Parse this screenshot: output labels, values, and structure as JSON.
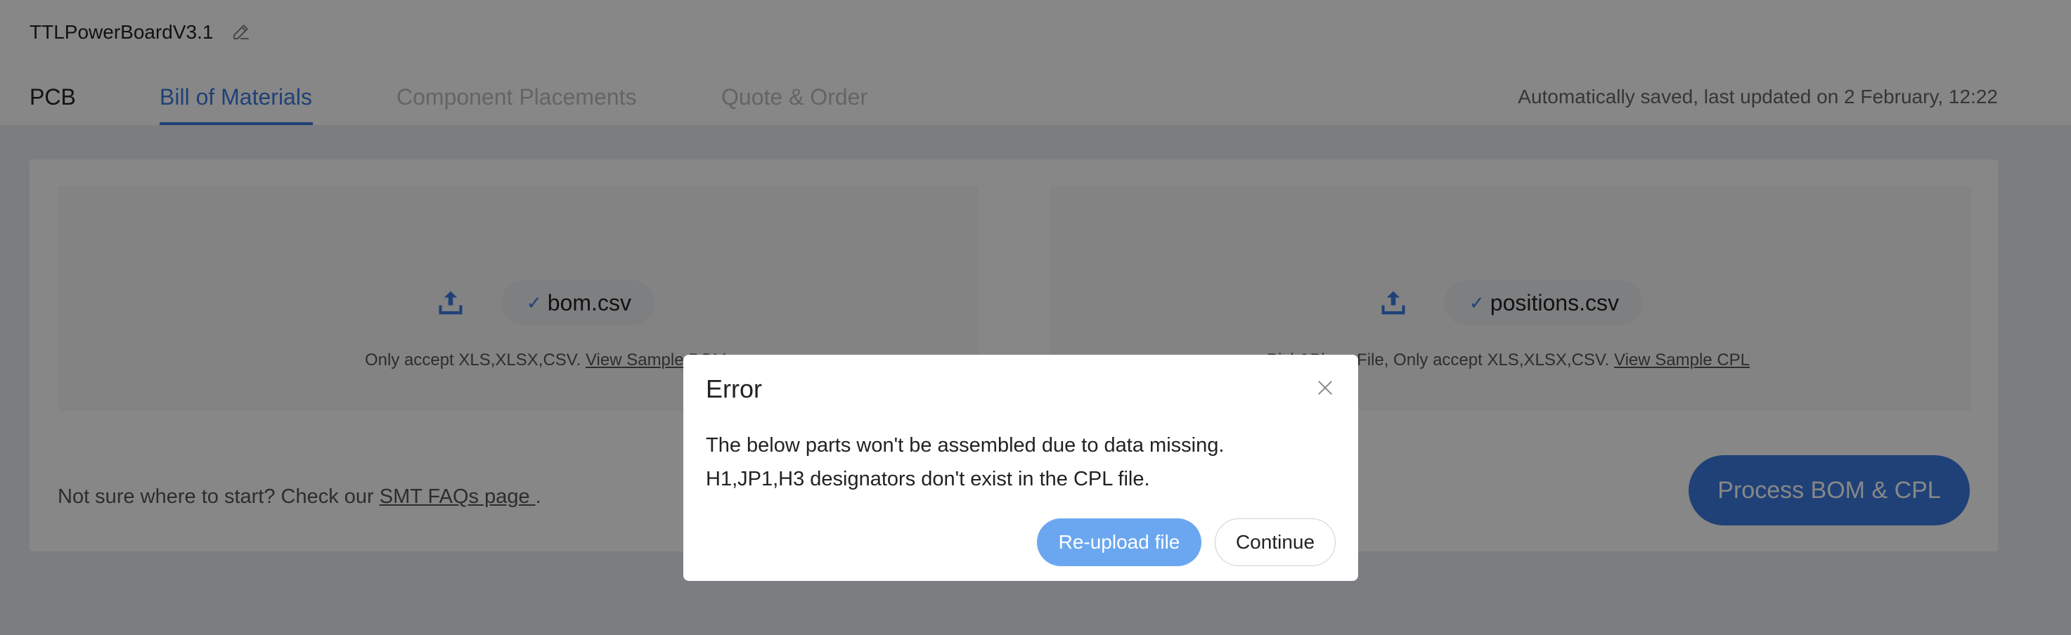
{
  "header": {
    "project_title": "TTLPowerBoardV3.1",
    "edit_icon": "pencil-icon",
    "autosave_status": "Automatically saved, last updated on 2 February, 12:22"
  },
  "tabs": [
    {
      "label": "PCB",
      "state": "normal"
    },
    {
      "label": "Bill of Materials",
      "state": "active"
    },
    {
      "label": "Component Placements",
      "state": "disabled"
    },
    {
      "label": "Quote & Order",
      "state": "disabled"
    }
  ],
  "bom_upload": {
    "icon": "upload-icon",
    "file_check": "✓",
    "file_name": "bom.csv",
    "hint": "Only accept XLS,XLSX,CSV.",
    "sample_link": "View Sample BOM"
  },
  "cpl_upload": {
    "icon": "upload-icon",
    "file_check": "✓",
    "file_name": "positions.csv",
    "hint": "Pick&Place File, Only accept XLS,XLSX,CSV.",
    "sample_link": "View Sample CPL"
  },
  "footer": {
    "faq_prefix": "Not sure where to start? Check our",
    "faq_link": "SMT FAQs page ",
    "faq_suffix": ".",
    "process_button": "Process BOM & CPL"
  },
  "dialog": {
    "title": "Error",
    "close_icon": "close-icon",
    "message_line1": "The below parts won't be assembled due to data missing.",
    "message_line2": "H1,JP1,H3 designators don't exist in the CPL file.",
    "reupload_button": "Re-upload file",
    "continue_button": "Continue"
  },
  "colors": {
    "accent": "#3b7be0",
    "reupload_button": "#6ba7f0",
    "overlay": "rgba(0,0,0,0.47)"
  }
}
